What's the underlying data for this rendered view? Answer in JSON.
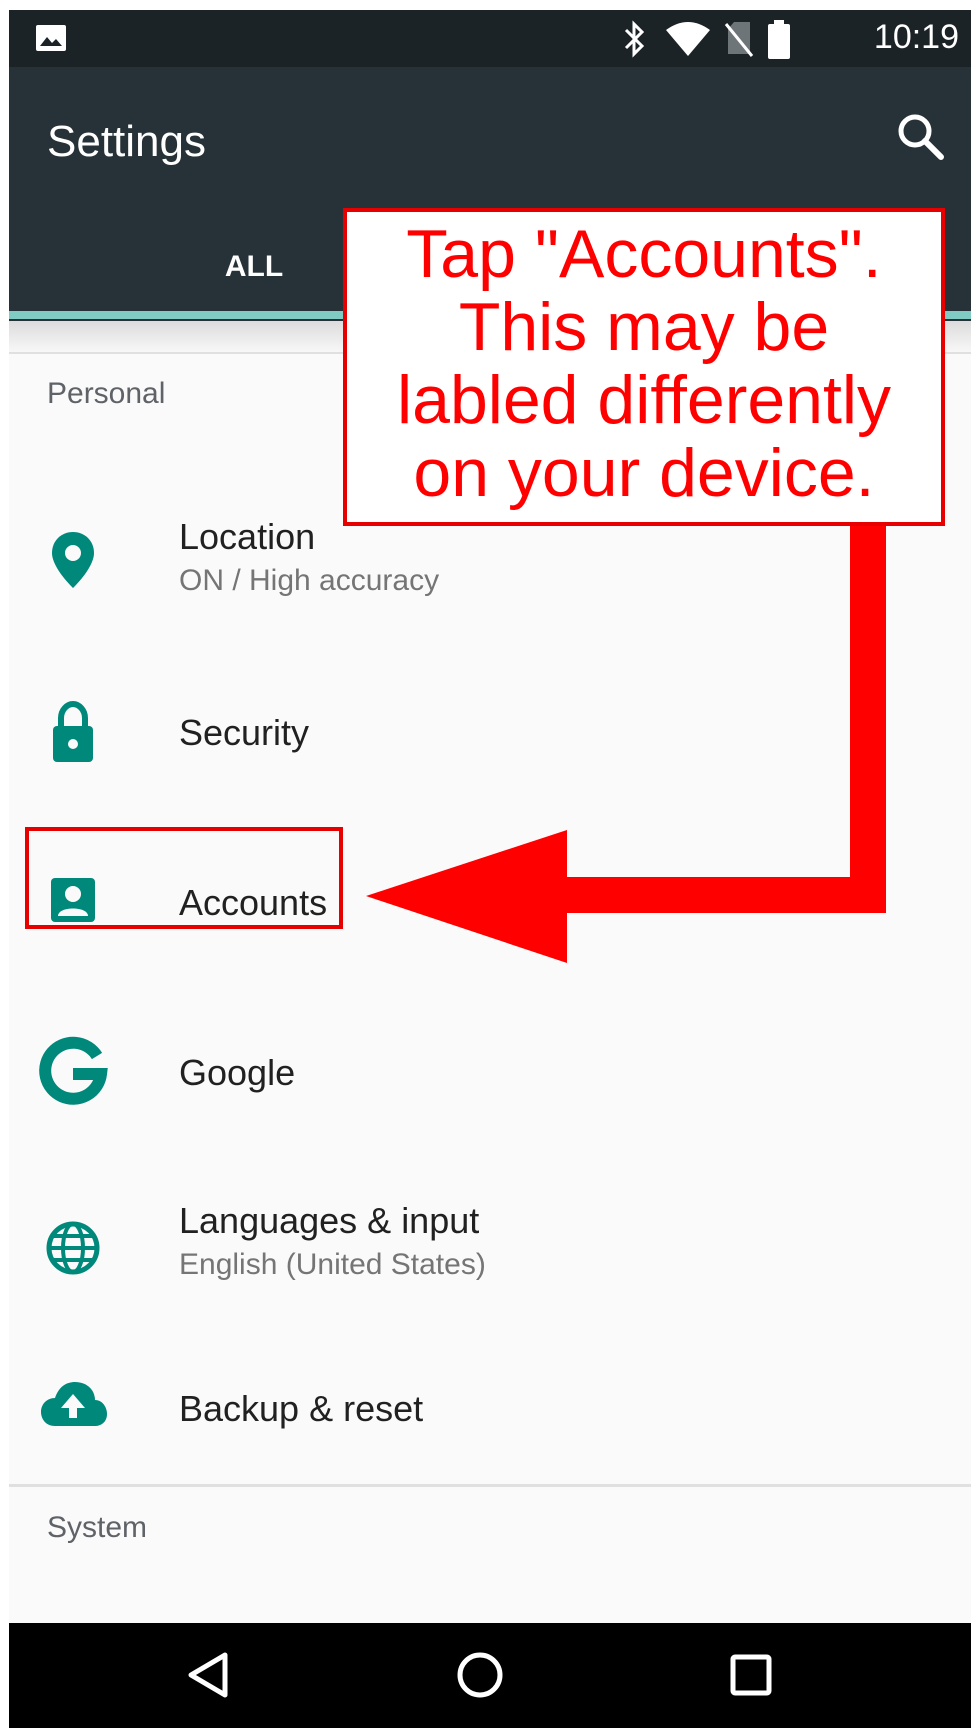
{
  "status_bar": {
    "time": "10:19"
  },
  "app_bar": {
    "title": "Settings",
    "tab_all": "ALL"
  },
  "sections": {
    "personal": "Personal",
    "system": "System"
  },
  "items": [
    {
      "label": "Location",
      "sub": "ON / High accuracy",
      "icon": "location-pin-icon"
    },
    {
      "label": "Security",
      "icon": "lock-icon"
    },
    {
      "label": "Accounts",
      "icon": "account-box-icon"
    },
    {
      "label": "Google",
      "icon": "google-g-icon"
    },
    {
      "label": "Languages & input",
      "sub": "English (United States)",
      "icon": "globe-icon"
    },
    {
      "label": "Backup & reset",
      "icon": "cloud-upload-icon"
    }
  ],
  "annotation": {
    "lines": [
      "Tap \"Accounts\".",
      "This may be",
      "labled differently",
      "on your device."
    ]
  },
  "colors": {
    "accent": "#00897b",
    "app_bar": "#263238",
    "status_bar": "#1b2327",
    "annotation": "#ff0000",
    "tab_indicator": "#80cbc4"
  }
}
